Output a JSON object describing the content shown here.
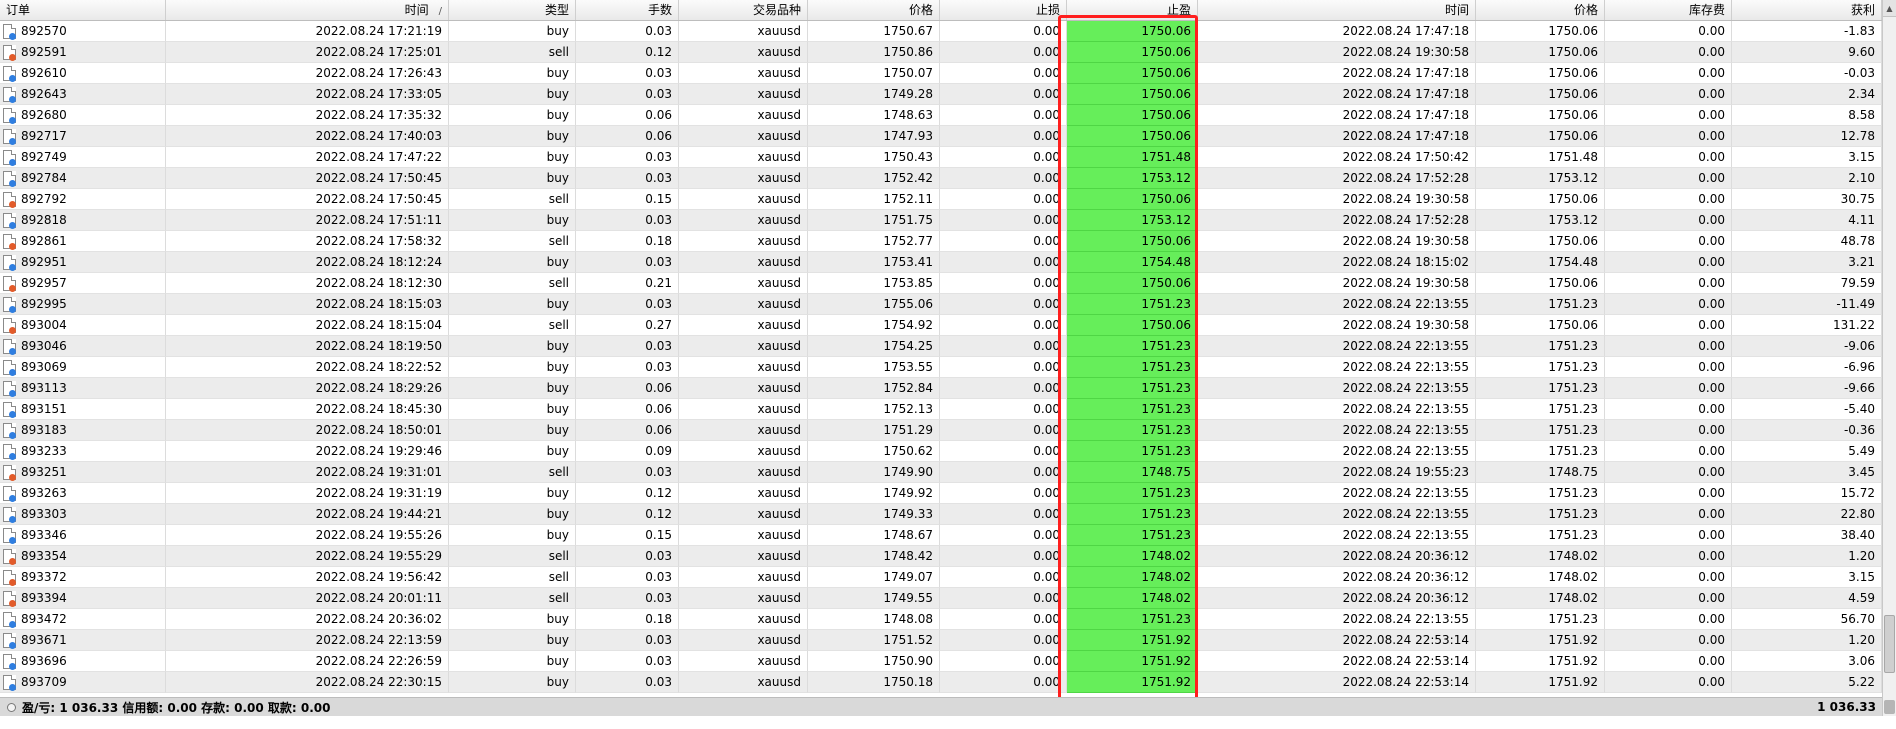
{
  "columns": [
    "订单",
    "时间",
    "类型",
    "手数",
    "交易品种",
    "价格",
    "止损",
    "止盈",
    "时间",
    "价格",
    "库存费",
    "获利"
  ],
  "rows": [
    {
      "order": "892570",
      "open_time": "2022.08.24 17:21:19",
      "type": "buy",
      "lots": "0.03",
      "symbol": "xauusd",
      "open_price": "1750.67",
      "sl": "0.00",
      "tp": "1750.06",
      "close_time": "2022.08.24 17:47:18",
      "close_price": "1750.06",
      "swap": "0.00",
      "profit": "-1.83"
    },
    {
      "order": "892591",
      "open_time": "2022.08.24 17:25:01",
      "type": "sell",
      "lots": "0.12",
      "symbol": "xauusd",
      "open_price": "1750.86",
      "sl": "0.00",
      "tp": "1750.06",
      "close_time": "2022.08.24 19:30:58",
      "close_price": "1750.06",
      "swap": "0.00",
      "profit": "9.60"
    },
    {
      "order": "892610",
      "open_time": "2022.08.24 17:26:43",
      "type": "buy",
      "lots": "0.03",
      "symbol": "xauusd",
      "open_price": "1750.07",
      "sl": "0.00",
      "tp": "1750.06",
      "close_time": "2022.08.24 17:47:18",
      "close_price": "1750.06",
      "swap": "0.00",
      "profit": "-0.03"
    },
    {
      "order": "892643",
      "open_time": "2022.08.24 17:33:05",
      "type": "buy",
      "lots": "0.03",
      "symbol": "xauusd",
      "open_price": "1749.28",
      "sl": "0.00",
      "tp": "1750.06",
      "close_time": "2022.08.24 17:47:18",
      "close_price": "1750.06",
      "swap": "0.00",
      "profit": "2.34"
    },
    {
      "order": "892680",
      "open_time": "2022.08.24 17:35:32",
      "type": "buy",
      "lots": "0.06",
      "symbol": "xauusd",
      "open_price": "1748.63",
      "sl": "0.00",
      "tp": "1750.06",
      "close_time": "2022.08.24 17:47:18",
      "close_price": "1750.06",
      "swap": "0.00",
      "profit": "8.58"
    },
    {
      "order": "892717",
      "open_time": "2022.08.24 17:40:03",
      "type": "buy",
      "lots": "0.06",
      "symbol": "xauusd",
      "open_price": "1747.93",
      "sl": "0.00",
      "tp": "1750.06",
      "close_time": "2022.08.24 17:47:18",
      "close_price": "1750.06",
      "swap": "0.00",
      "profit": "12.78"
    },
    {
      "order": "892749",
      "open_time": "2022.08.24 17:47:22",
      "type": "buy",
      "lots": "0.03",
      "symbol": "xauusd",
      "open_price": "1750.43",
      "sl": "0.00",
      "tp": "1751.48",
      "close_time": "2022.08.24 17:50:42",
      "close_price": "1751.48",
      "swap": "0.00",
      "profit": "3.15"
    },
    {
      "order": "892784",
      "open_time": "2022.08.24 17:50:45",
      "type": "buy",
      "lots": "0.03",
      "symbol": "xauusd",
      "open_price": "1752.42",
      "sl": "0.00",
      "tp": "1753.12",
      "close_time": "2022.08.24 17:52:28",
      "close_price": "1753.12",
      "swap": "0.00",
      "profit": "2.10"
    },
    {
      "order": "892792",
      "open_time": "2022.08.24 17:50:45",
      "type": "sell",
      "lots": "0.15",
      "symbol": "xauusd",
      "open_price": "1752.11",
      "sl": "0.00",
      "tp": "1750.06",
      "close_time": "2022.08.24 19:30:58",
      "close_price": "1750.06",
      "swap": "0.00",
      "profit": "30.75"
    },
    {
      "order": "892818",
      "open_time": "2022.08.24 17:51:11",
      "type": "buy",
      "lots": "0.03",
      "symbol": "xauusd",
      "open_price": "1751.75",
      "sl": "0.00",
      "tp": "1753.12",
      "close_time": "2022.08.24 17:52:28",
      "close_price": "1753.12",
      "swap": "0.00",
      "profit": "4.11"
    },
    {
      "order": "892861",
      "open_time": "2022.08.24 17:58:32",
      "type": "sell",
      "lots": "0.18",
      "symbol": "xauusd",
      "open_price": "1752.77",
      "sl": "0.00",
      "tp": "1750.06",
      "close_time": "2022.08.24 19:30:58",
      "close_price": "1750.06",
      "swap": "0.00",
      "profit": "48.78"
    },
    {
      "order": "892951",
      "open_time": "2022.08.24 18:12:24",
      "type": "buy",
      "lots": "0.03",
      "symbol": "xauusd",
      "open_price": "1753.41",
      "sl": "0.00",
      "tp": "1754.48",
      "close_time": "2022.08.24 18:15:02",
      "close_price": "1754.48",
      "swap": "0.00",
      "profit": "3.21"
    },
    {
      "order": "892957",
      "open_time": "2022.08.24 18:12:30",
      "type": "sell",
      "lots": "0.21",
      "symbol": "xauusd",
      "open_price": "1753.85",
      "sl": "0.00",
      "tp": "1750.06",
      "close_time": "2022.08.24 19:30:58",
      "close_price": "1750.06",
      "swap": "0.00",
      "profit": "79.59"
    },
    {
      "order": "892995",
      "open_time": "2022.08.24 18:15:03",
      "type": "buy",
      "lots": "0.03",
      "symbol": "xauusd",
      "open_price": "1755.06",
      "sl": "0.00",
      "tp": "1751.23",
      "close_time": "2022.08.24 22:13:55",
      "close_price": "1751.23",
      "swap": "0.00",
      "profit": "-11.49"
    },
    {
      "order": "893004",
      "open_time": "2022.08.24 18:15:04",
      "type": "sell",
      "lots": "0.27",
      "symbol": "xauusd",
      "open_price": "1754.92",
      "sl": "0.00",
      "tp": "1750.06",
      "close_time": "2022.08.24 19:30:58",
      "close_price": "1750.06",
      "swap": "0.00",
      "profit": "131.22"
    },
    {
      "order": "893046",
      "open_time": "2022.08.24 18:19:50",
      "type": "buy",
      "lots": "0.03",
      "symbol": "xauusd",
      "open_price": "1754.25",
      "sl": "0.00",
      "tp": "1751.23",
      "close_time": "2022.08.24 22:13:55",
      "close_price": "1751.23",
      "swap": "0.00",
      "profit": "-9.06"
    },
    {
      "order": "893069",
      "open_time": "2022.08.24 18:22:52",
      "type": "buy",
      "lots": "0.03",
      "symbol": "xauusd",
      "open_price": "1753.55",
      "sl": "0.00",
      "tp": "1751.23",
      "close_time": "2022.08.24 22:13:55",
      "close_price": "1751.23",
      "swap": "0.00",
      "profit": "-6.96"
    },
    {
      "order": "893113",
      "open_time": "2022.08.24 18:29:26",
      "type": "buy",
      "lots": "0.06",
      "symbol": "xauusd",
      "open_price": "1752.84",
      "sl": "0.00",
      "tp": "1751.23",
      "close_time": "2022.08.24 22:13:55",
      "close_price": "1751.23",
      "swap": "0.00",
      "profit": "-9.66"
    },
    {
      "order": "893151",
      "open_time": "2022.08.24 18:45:30",
      "type": "buy",
      "lots": "0.06",
      "symbol": "xauusd",
      "open_price": "1752.13",
      "sl": "0.00",
      "tp": "1751.23",
      "close_time": "2022.08.24 22:13:55",
      "close_price": "1751.23",
      "swap": "0.00",
      "profit": "-5.40"
    },
    {
      "order": "893183",
      "open_time": "2022.08.24 18:50:01",
      "type": "buy",
      "lots": "0.06",
      "symbol": "xauusd",
      "open_price": "1751.29",
      "sl": "0.00",
      "tp": "1751.23",
      "close_time": "2022.08.24 22:13:55",
      "close_price": "1751.23",
      "swap": "0.00",
      "profit": "-0.36"
    },
    {
      "order": "893233",
      "open_time": "2022.08.24 19:29:46",
      "type": "buy",
      "lots": "0.09",
      "symbol": "xauusd",
      "open_price": "1750.62",
      "sl": "0.00",
      "tp": "1751.23",
      "close_time": "2022.08.24 22:13:55",
      "close_price": "1751.23",
      "swap": "0.00",
      "profit": "5.49"
    },
    {
      "order": "893251",
      "open_time": "2022.08.24 19:31:01",
      "type": "sell",
      "lots": "0.03",
      "symbol": "xauusd",
      "open_price": "1749.90",
      "sl": "0.00",
      "tp": "1748.75",
      "close_time": "2022.08.24 19:55:23",
      "close_price": "1748.75",
      "swap": "0.00",
      "profit": "3.45"
    },
    {
      "order": "893263",
      "open_time": "2022.08.24 19:31:19",
      "type": "buy",
      "lots": "0.12",
      "symbol": "xauusd",
      "open_price": "1749.92",
      "sl": "0.00",
      "tp": "1751.23",
      "close_time": "2022.08.24 22:13:55",
      "close_price": "1751.23",
      "swap": "0.00",
      "profit": "15.72"
    },
    {
      "order": "893303",
      "open_time": "2022.08.24 19:44:21",
      "type": "buy",
      "lots": "0.12",
      "symbol": "xauusd",
      "open_price": "1749.33",
      "sl": "0.00",
      "tp": "1751.23",
      "close_time": "2022.08.24 22:13:55",
      "close_price": "1751.23",
      "swap": "0.00",
      "profit": "22.80"
    },
    {
      "order": "893346",
      "open_time": "2022.08.24 19:55:26",
      "type": "buy",
      "lots": "0.15",
      "symbol": "xauusd",
      "open_price": "1748.67",
      "sl": "0.00",
      "tp": "1751.23",
      "close_time": "2022.08.24 22:13:55",
      "close_price": "1751.23",
      "swap": "0.00",
      "profit": "38.40"
    },
    {
      "order": "893354",
      "open_time": "2022.08.24 19:55:29",
      "type": "sell",
      "lots": "0.03",
      "symbol": "xauusd",
      "open_price": "1748.42",
      "sl": "0.00",
      "tp": "1748.02",
      "close_time": "2022.08.24 20:36:12",
      "close_price": "1748.02",
      "swap": "0.00",
      "profit": "1.20"
    },
    {
      "order": "893372",
      "open_time": "2022.08.24 19:56:42",
      "type": "sell",
      "lots": "0.03",
      "symbol": "xauusd",
      "open_price": "1749.07",
      "sl": "0.00",
      "tp": "1748.02",
      "close_time": "2022.08.24 20:36:12",
      "close_price": "1748.02",
      "swap": "0.00",
      "profit": "3.15"
    },
    {
      "order": "893394",
      "open_time": "2022.08.24 20:01:11",
      "type": "sell",
      "lots": "0.03",
      "symbol": "xauusd",
      "open_price": "1749.55",
      "sl": "0.00",
      "tp": "1748.02",
      "close_time": "2022.08.24 20:36:12",
      "close_price": "1748.02",
      "swap": "0.00",
      "profit": "4.59"
    },
    {
      "order": "893472",
      "open_time": "2022.08.24 20:36:02",
      "type": "buy",
      "lots": "0.18",
      "symbol": "xauusd",
      "open_price": "1748.08",
      "sl": "0.00",
      "tp": "1751.23",
      "close_time": "2022.08.24 22:13:55",
      "close_price": "1751.23",
      "swap": "0.00",
      "profit": "56.70"
    },
    {
      "order": "893671",
      "open_time": "2022.08.24 22:13:59",
      "type": "buy",
      "lots": "0.03",
      "symbol": "xauusd",
      "open_price": "1751.52",
      "sl": "0.00",
      "tp": "1751.92",
      "close_time": "2022.08.24 22:53:14",
      "close_price": "1751.92",
      "swap": "0.00",
      "profit": "1.20"
    },
    {
      "order": "893696",
      "open_time": "2022.08.24 22:26:59",
      "type": "buy",
      "lots": "0.03",
      "symbol": "xauusd",
      "open_price": "1750.90",
      "sl": "0.00",
      "tp": "1751.92",
      "close_time": "2022.08.24 22:53:14",
      "close_price": "1751.92",
      "swap": "0.00",
      "profit": "3.06"
    },
    {
      "order": "893709",
      "open_time": "2022.08.24 22:30:15",
      "type": "buy",
      "lots": "0.03",
      "symbol": "xauusd",
      "open_price": "1750.18",
      "sl": "0.00",
      "tp": "1751.92",
      "close_time": "2022.08.24 22:53:14",
      "close_price": "1751.92",
      "swap": "0.00",
      "profit": "5.22"
    }
  ],
  "footer": {
    "summary": "盈/亏: 1 036.33  信用额: 0.00  存款: 0.00  取款: 0.00",
    "total": "1 036.33"
  },
  "colors": {
    "take_profit_fill": "#66ee5a",
    "highlight_border": "#ff1e1e",
    "buy_icon": "#2f7ee0",
    "sell_icon": "#e25b2a"
  },
  "icons": {
    "order": "document-icon",
    "sort": "sort-ascending-icon"
  }
}
